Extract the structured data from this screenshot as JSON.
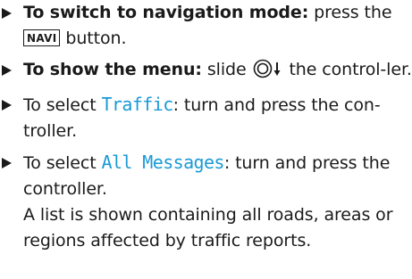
{
  "steps": [
    {
      "lead_bold": "To switch to navigation mode:",
      "text_before_key": " press the ",
      "key_label": "NAVI",
      "text_after_key": " button."
    },
    {
      "lead_bold": "To show the menu:",
      "text_before_icon": " slide ",
      "icon": "controller-slide-down-icon",
      "text_after_icon": " the control-ler."
    },
    {
      "text_before": "To select ",
      "display_text": "Traffic",
      "text_after": ": turn and press the con-troller."
    },
    {
      "text_before": "To select ",
      "display_text": "All Messages",
      "text_after": ": turn and press the controller.",
      "result": "A list is shown containing all roads, areas or regions affected by traffic reports."
    }
  ],
  "colors": {
    "display_text": "#1a9ad6",
    "body_text": "#1a1a1a"
  }
}
